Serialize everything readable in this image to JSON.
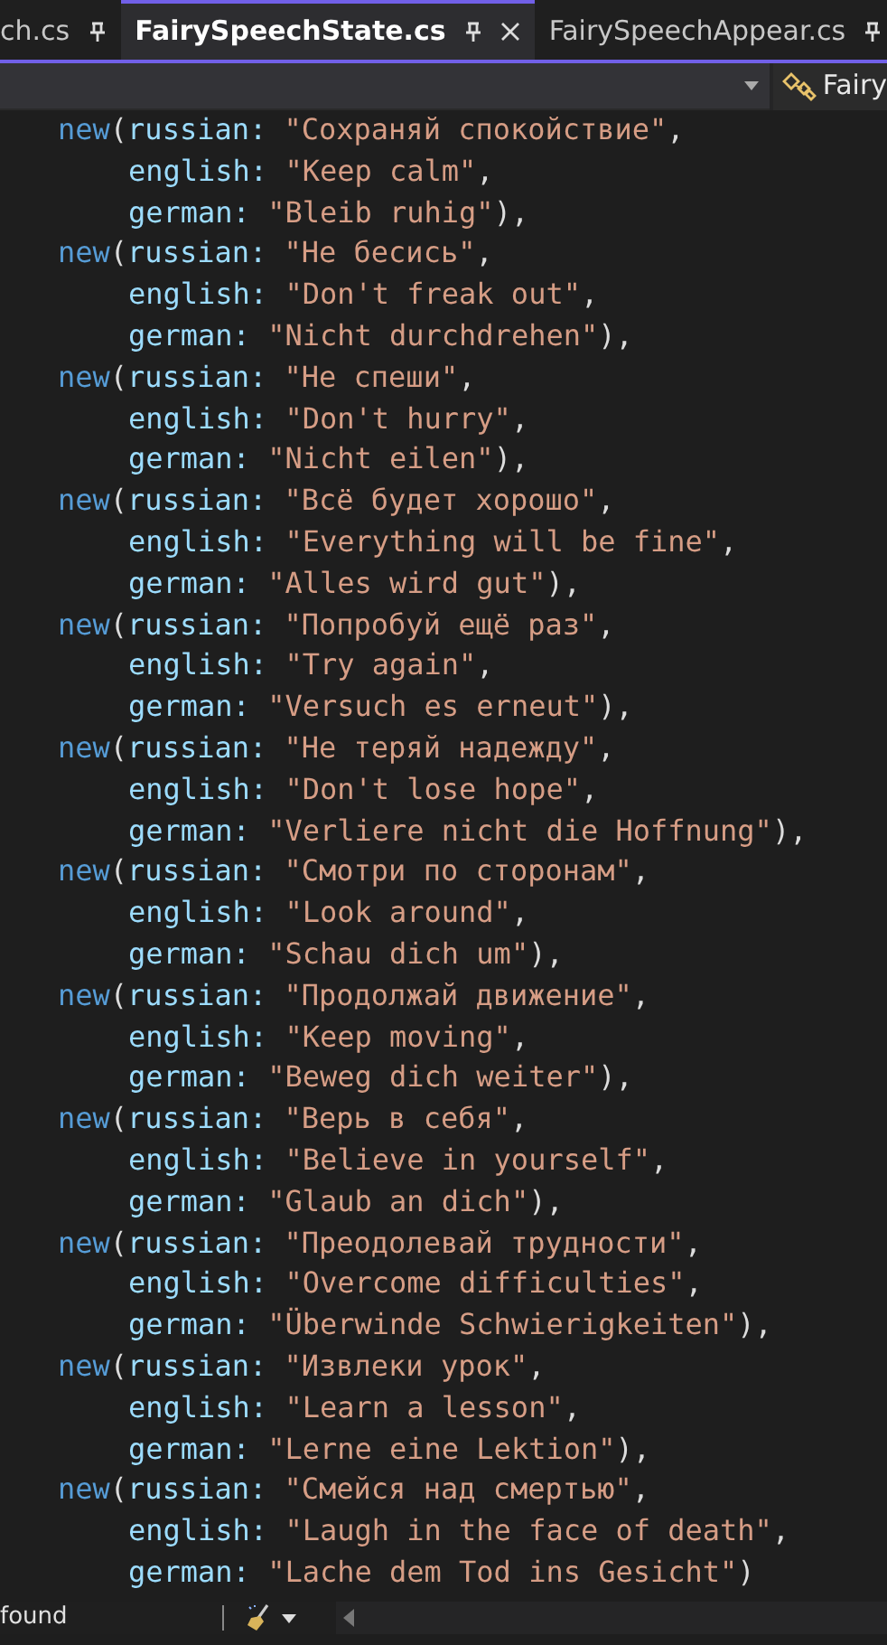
{
  "tabs": [
    {
      "label": "ch.cs",
      "selected": false,
      "closable": false
    },
    {
      "label": "FairySpeechState.cs",
      "selected": true,
      "closable": true
    },
    {
      "label": "FairySpeechAppear.cs",
      "selected": false,
      "closable": false
    }
  ],
  "nav_bar": {
    "member": "Fairy"
  },
  "code_lines": [
    {
      "kind": "open",
      "keyword": "new",
      "paren": "(",
      "param": "russian:",
      "value": "\"Сохраняй спокойствие\"",
      "punct": ","
    },
    {
      "kind": "arg",
      "param": "english:",
      "value": "\"Keep calm\"",
      "punct": ","
    },
    {
      "kind": "arg",
      "param": "german:",
      "value": "\"Bleib ruhig\"",
      "punct": "),"
    },
    {
      "kind": "open",
      "keyword": "new",
      "paren": "(",
      "param": "russian:",
      "value": "\"Не бесись\"",
      "punct": ","
    },
    {
      "kind": "arg",
      "param": "english:",
      "value": "\"Don't freak out\"",
      "punct": ","
    },
    {
      "kind": "arg",
      "param": "german:",
      "value": "\"Nicht durchdrehen\"",
      "punct": "),"
    },
    {
      "kind": "open",
      "keyword": "new",
      "paren": "(",
      "param": "russian:",
      "value": "\"Не спеши\"",
      "punct": ","
    },
    {
      "kind": "arg",
      "param": "english:",
      "value": "\"Don't hurry\"",
      "punct": ","
    },
    {
      "kind": "arg",
      "param": "german:",
      "value": "\"Nicht eilen\"",
      "punct": "),"
    },
    {
      "kind": "open",
      "keyword": "new",
      "paren": "(",
      "param": "russian:",
      "value": "\"Всё будет хорошо\"",
      "punct": ","
    },
    {
      "kind": "arg",
      "param": "english:",
      "value": "\"Everything will be fine\"",
      "punct": ","
    },
    {
      "kind": "arg",
      "param": "german:",
      "value": "\"Alles wird gut\"",
      "punct": "),"
    },
    {
      "kind": "open",
      "keyword": "new",
      "paren": "(",
      "param": "russian:",
      "value": "\"Попробуй ещё раз\"",
      "punct": ","
    },
    {
      "kind": "arg",
      "param": "english:",
      "value": "\"Try again\"",
      "punct": ","
    },
    {
      "kind": "arg",
      "param": "german:",
      "value": "\"Versuch es erneut\"",
      "punct": "),"
    },
    {
      "kind": "open",
      "keyword": "new",
      "paren": "(",
      "param": "russian:",
      "value": "\"Не теряй надежду\"",
      "punct": ","
    },
    {
      "kind": "arg",
      "param": "english:",
      "value": "\"Don't lose hope\"",
      "punct": ","
    },
    {
      "kind": "arg",
      "param": "german:",
      "value": "\"Verliere nicht die Hoffnung\"",
      "punct": "),"
    },
    {
      "kind": "open",
      "keyword": "new",
      "paren": "(",
      "param": "russian:",
      "value": "\"Смотри по сторонам\"",
      "punct": ","
    },
    {
      "kind": "arg",
      "param": "english:",
      "value": "\"Look around\"",
      "punct": ","
    },
    {
      "kind": "arg",
      "param": "german:",
      "value": "\"Schau dich um\"",
      "punct": "),"
    },
    {
      "kind": "open",
      "keyword": "new",
      "paren": "(",
      "param": "russian:",
      "value": "\"Продолжай движение\"",
      "punct": ","
    },
    {
      "kind": "arg",
      "param": "english:",
      "value": "\"Keep moving\"",
      "punct": ","
    },
    {
      "kind": "arg",
      "param": "german:",
      "value": "\"Beweg dich weiter\"",
      "punct": "),"
    },
    {
      "kind": "open",
      "keyword": "new",
      "paren": "(",
      "param": "russian:",
      "value": "\"Верь в себя\"",
      "punct": ","
    },
    {
      "kind": "arg",
      "param": "english:",
      "value": "\"Believe in yourself\"",
      "punct": ","
    },
    {
      "kind": "arg",
      "param": "german:",
      "value": "\"Glaub an dich\"",
      "punct": "),"
    },
    {
      "kind": "open",
      "keyword": "new",
      "paren": "(",
      "param": "russian:",
      "value": "\"Преодолевай трудности\"",
      "punct": ","
    },
    {
      "kind": "arg",
      "param": "english:",
      "value": "\"Overcome difficulties\"",
      "punct": ","
    },
    {
      "kind": "arg",
      "param": "german:",
      "value": "\"Überwinde Schwierigkeiten\"",
      "punct": "),"
    },
    {
      "kind": "open",
      "keyword": "new",
      "paren": "(",
      "param": "russian:",
      "value": "\"Извлеки урок\"",
      "punct": ","
    },
    {
      "kind": "arg",
      "param": "english:",
      "value": "\"Learn a lesson\"",
      "punct": ","
    },
    {
      "kind": "arg",
      "param": "german:",
      "value": "\"Lerne eine Lektion\"",
      "punct": "),"
    },
    {
      "kind": "open",
      "keyword": "new",
      "paren": "(",
      "param": "russian:",
      "value": "\"Смейся над смертью\"",
      "punct": ","
    },
    {
      "kind": "arg",
      "param": "english:",
      "value": "\"Laugh in the face of death\"",
      "punct": ","
    },
    {
      "kind": "arg",
      "param": "german:",
      "value": "\"Lache dem Tod ins Gesicht\"",
      "punct": ")"
    }
  ],
  "status_bar": {
    "message": "found"
  }
}
